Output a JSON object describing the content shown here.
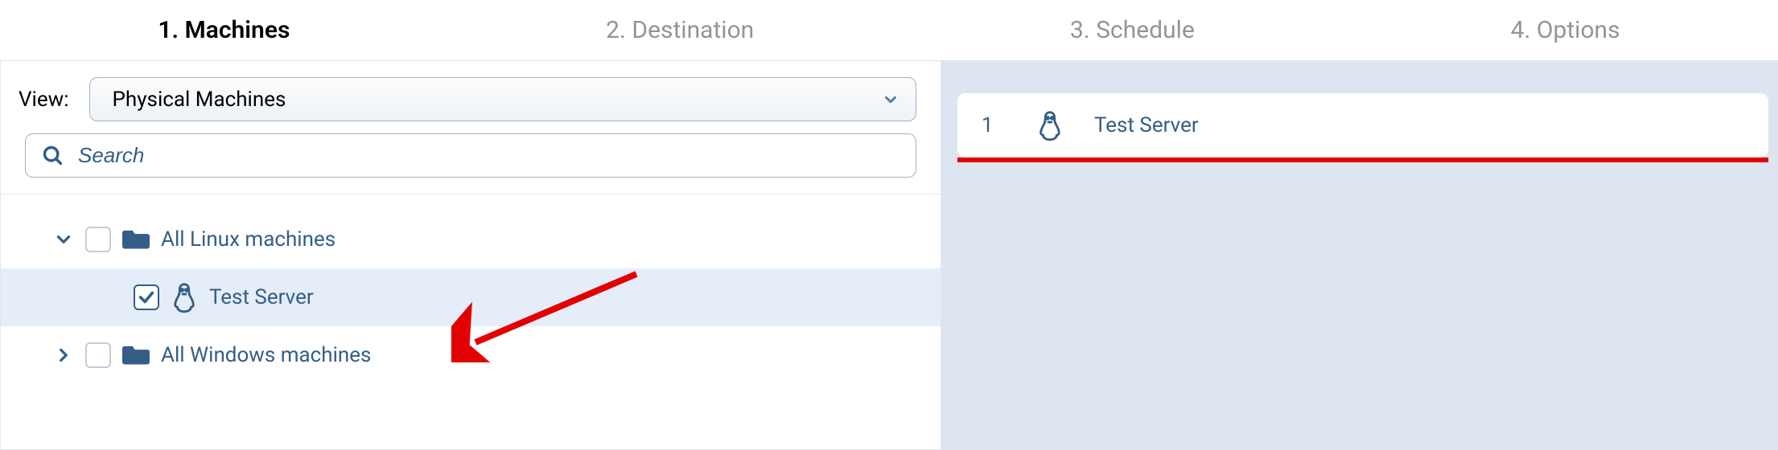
{
  "wizard": {
    "tabs": [
      {
        "label": "1. Machines",
        "active": true
      },
      {
        "label": "2. Destination",
        "active": false
      },
      {
        "label": "3. Schedule",
        "active": false
      },
      {
        "label": "4. Options",
        "active": false
      }
    ]
  },
  "view": {
    "label": "View:",
    "selected": "Physical Machines"
  },
  "search": {
    "placeholder": "Search"
  },
  "tree": {
    "group_linux": {
      "label": "All Linux machines"
    },
    "item_test_server": {
      "label": "Test Server"
    },
    "group_windows": {
      "label": "All Windows machines"
    }
  },
  "selected": {
    "items": [
      {
        "index": "1",
        "label": "Test Server"
      }
    ]
  }
}
